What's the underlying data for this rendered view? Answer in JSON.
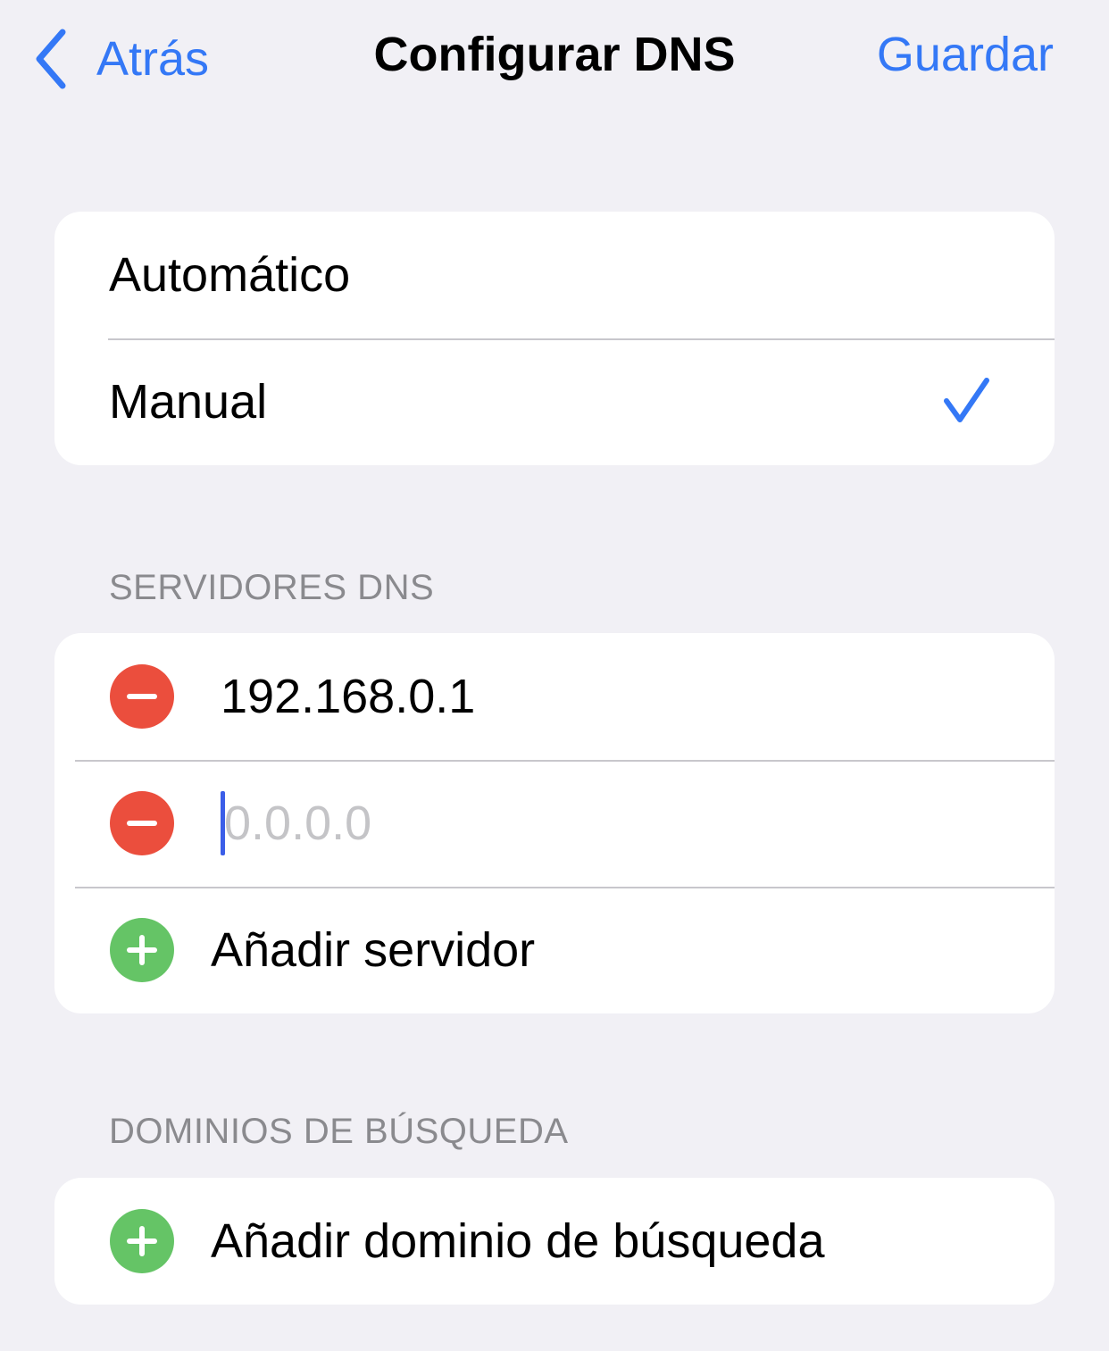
{
  "nav": {
    "back_label": "Atrás",
    "title": "Configurar DNS",
    "save_label": "Guardar"
  },
  "mode": {
    "options": [
      {
        "label": "Automático",
        "selected": false
      },
      {
        "label": "Manual",
        "selected": true
      }
    ]
  },
  "dns_servers": {
    "header": "SERVIDORES DNS",
    "servers": [
      {
        "value": "192.168.0.1",
        "placeholder": ""
      },
      {
        "value": "",
        "placeholder": "0.0.0.0"
      }
    ],
    "add_label": "Añadir servidor"
  },
  "search_domains": {
    "header": "DOMINIOS DE BÚSQUEDA",
    "add_label": "Añadir dominio de búsqueda"
  },
  "colors": {
    "accent": "#3478f6",
    "remove": "#eb4e3d",
    "add": "#65c466",
    "background": "#f1f0f5"
  }
}
